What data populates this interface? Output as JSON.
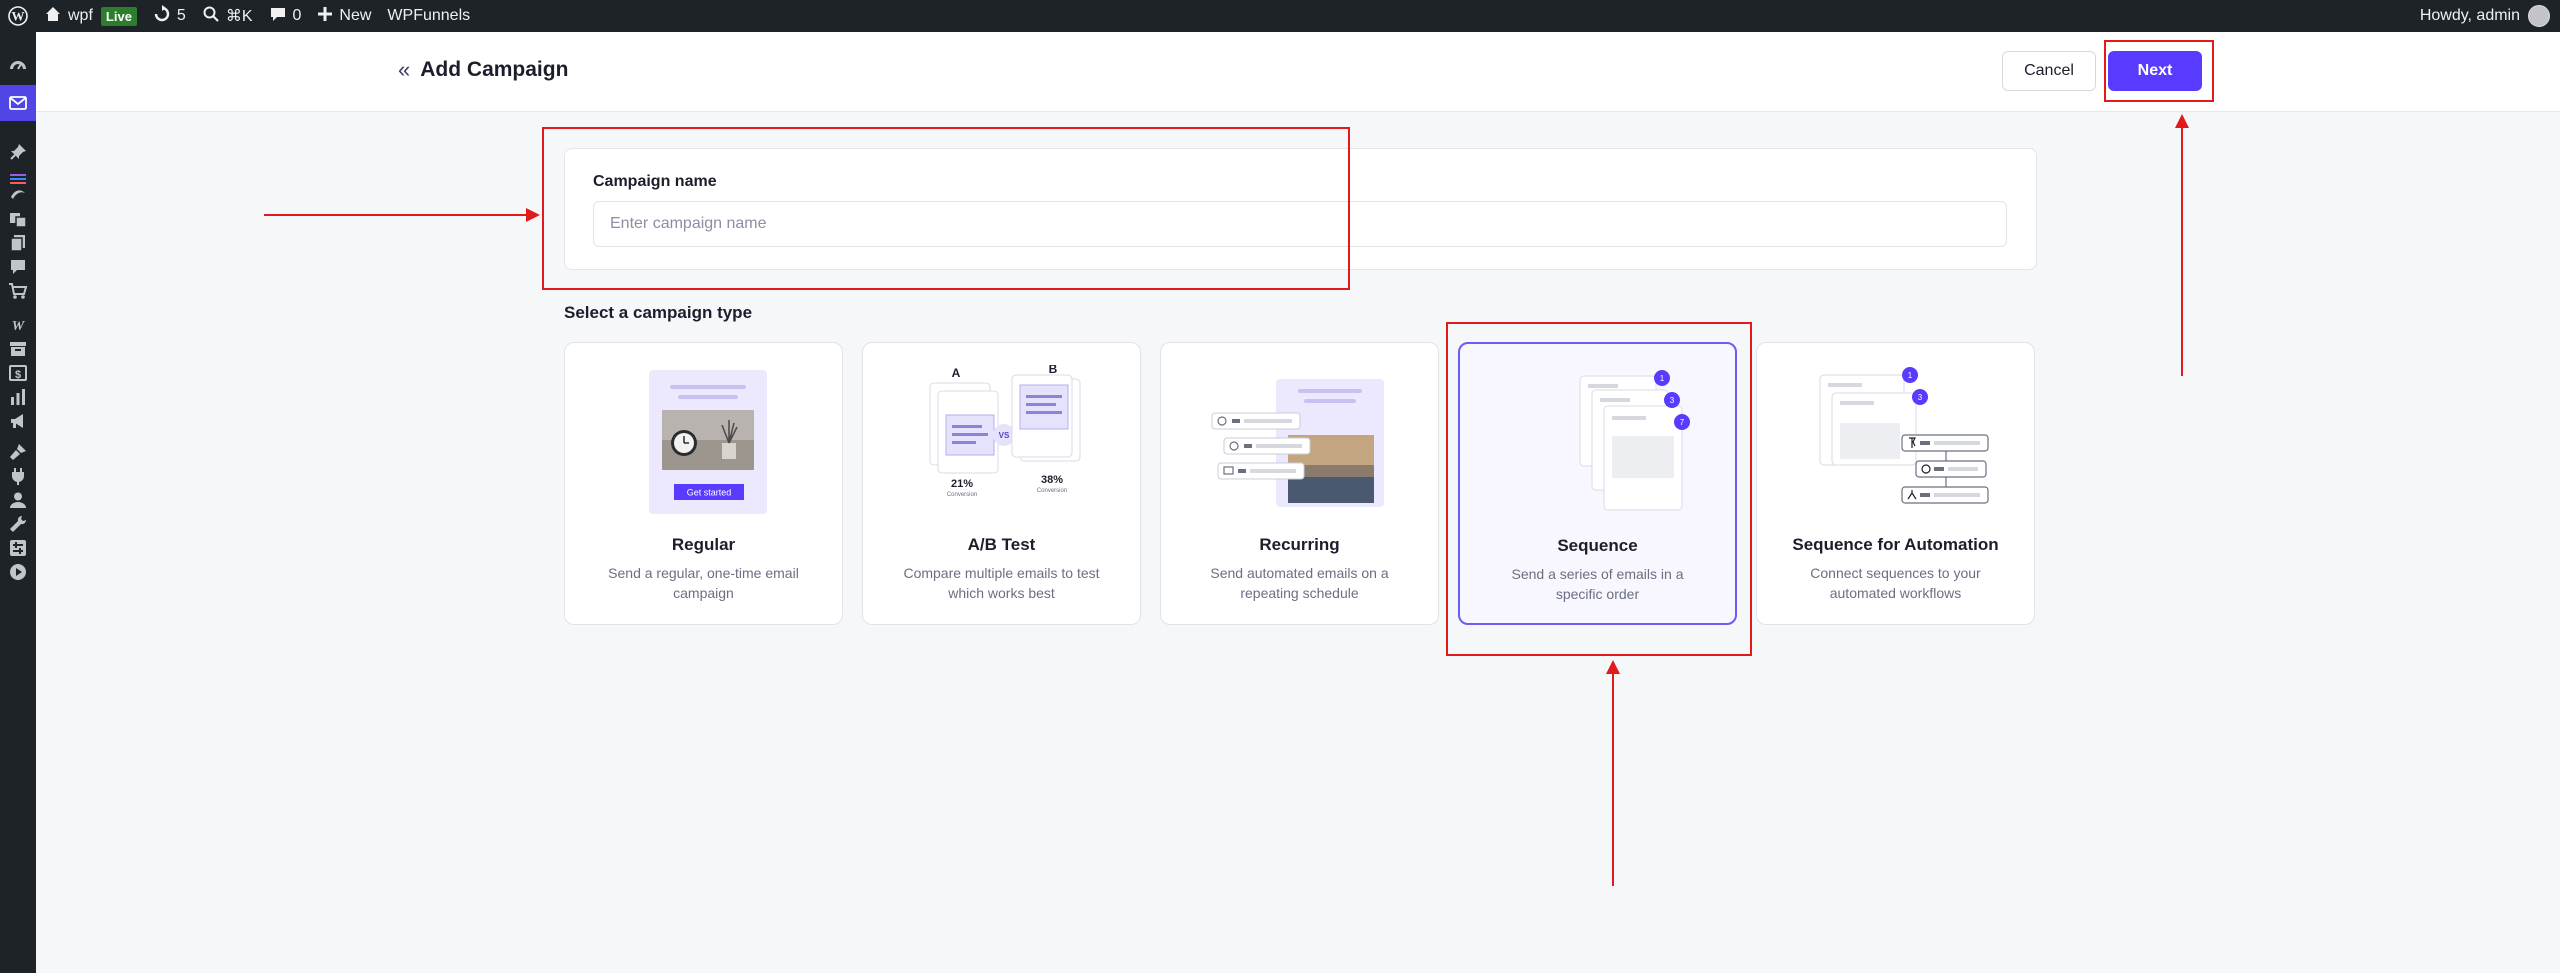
{
  "adminbar": {
    "site_name": "wpf",
    "live_badge": "Live",
    "updates_count": "5",
    "search_shortcut": "⌘K",
    "comments_count": "0",
    "new_label": "New",
    "plugin_label": "WPFunnels",
    "greeting": "Howdy, admin"
  },
  "header": {
    "title": "Add Campaign",
    "back_icon": "double-chevron-left-icon",
    "cancel_label": "Cancel",
    "next_label": "Next"
  },
  "campaign_name": {
    "label": "Campaign name",
    "placeholder": "Enter campaign name",
    "value": ""
  },
  "campaign_type": {
    "section_title": "Select a campaign type",
    "options": [
      {
        "title": "Regular",
        "description": "Send a regular, one-time email campaign",
        "illustration_button": "Get started",
        "selected": false
      },
      {
        "title": "A/B Test",
        "description": "Compare multiple emails to test which works best",
        "variant_a": "A",
        "variant_b": "B",
        "vs": "VS",
        "rate_a": "21%",
        "rate_b": "38%",
        "rate_label": "Conversion",
        "selected": false
      },
      {
        "title": "Recurring",
        "description": "Send automated emails on a repeating schedule",
        "selected": false
      },
      {
        "title": "Sequence",
        "description": "Send a series of emails in a specific order",
        "steps": [
          "1",
          "3",
          "7"
        ],
        "selected": true
      },
      {
        "title": "Sequence for Automation",
        "description": "Connect sequences to your automated workflows",
        "steps": [
          "1",
          "3"
        ],
        "selected": false
      }
    ]
  },
  "colors": {
    "accent": "#573bff",
    "annotation": "#e11b1b",
    "adminbar_bg": "#1d2327"
  }
}
